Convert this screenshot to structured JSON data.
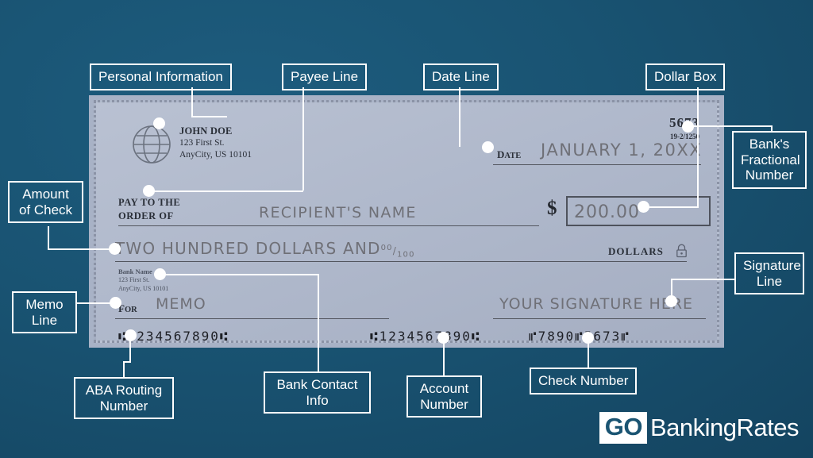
{
  "check": {
    "personal_info": {
      "name": "JOHN DOE",
      "street": "123 First St.",
      "city_state_zip": "AnyCity, US 10101"
    },
    "check_number": "5673",
    "fractional_number": "19-2/1250",
    "date_label": "DATE",
    "date_value": "JANUARY 1, 20XX",
    "pay_to_line1": "PAY TO THE",
    "pay_to_line2": "ORDER OF",
    "payee_value": "RECIPIENT'S NAME",
    "dollar_sign": "$",
    "dollar_amount": "200.00",
    "amount_words": "TWO HUNDRED DOLLARS AND",
    "amount_fraction_num": "00",
    "amount_fraction_den": "100",
    "dollars_label": "DOLLARS",
    "bank_info": {
      "name": "Bank Name",
      "street": "123 First St.",
      "city_state_zip": "AnyCity, US 10101"
    },
    "for_label": "FOR",
    "memo_value": "MEMO",
    "signature_value": "YOUR SIGNATURE HERE",
    "micr": {
      "routing": "⑆1234567890⑆",
      "account": "⑆1234567890⑆",
      "check": "⑈7890⑈5673⑈"
    }
  },
  "callouts": {
    "personal_information": "Personal Information",
    "payee_line": "Payee Line",
    "date_line": "Date Line",
    "dollar_box": "Dollar Box",
    "banks_fractional_number": "Bank's\nFractional\nNumber",
    "amount_of_check": "Amount\nof Check",
    "signature_line": "Signature\nLine",
    "memo_line": "Memo\nLine",
    "aba_routing_number": "ABA Routing\nNumber",
    "bank_contact_info": "Bank Contact\nInfo",
    "account_number": "Account\nNumber",
    "check_number": "Check Number"
  },
  "logo": {
    "go": "GO",
    "rest": "BankingRates"
  },
  "colors": {
    "background": "#195372",
    "check_face": "#b0b9cb",
    "callout_border": "#ffffff",
    "ink": "#6f7077"
  }
}
